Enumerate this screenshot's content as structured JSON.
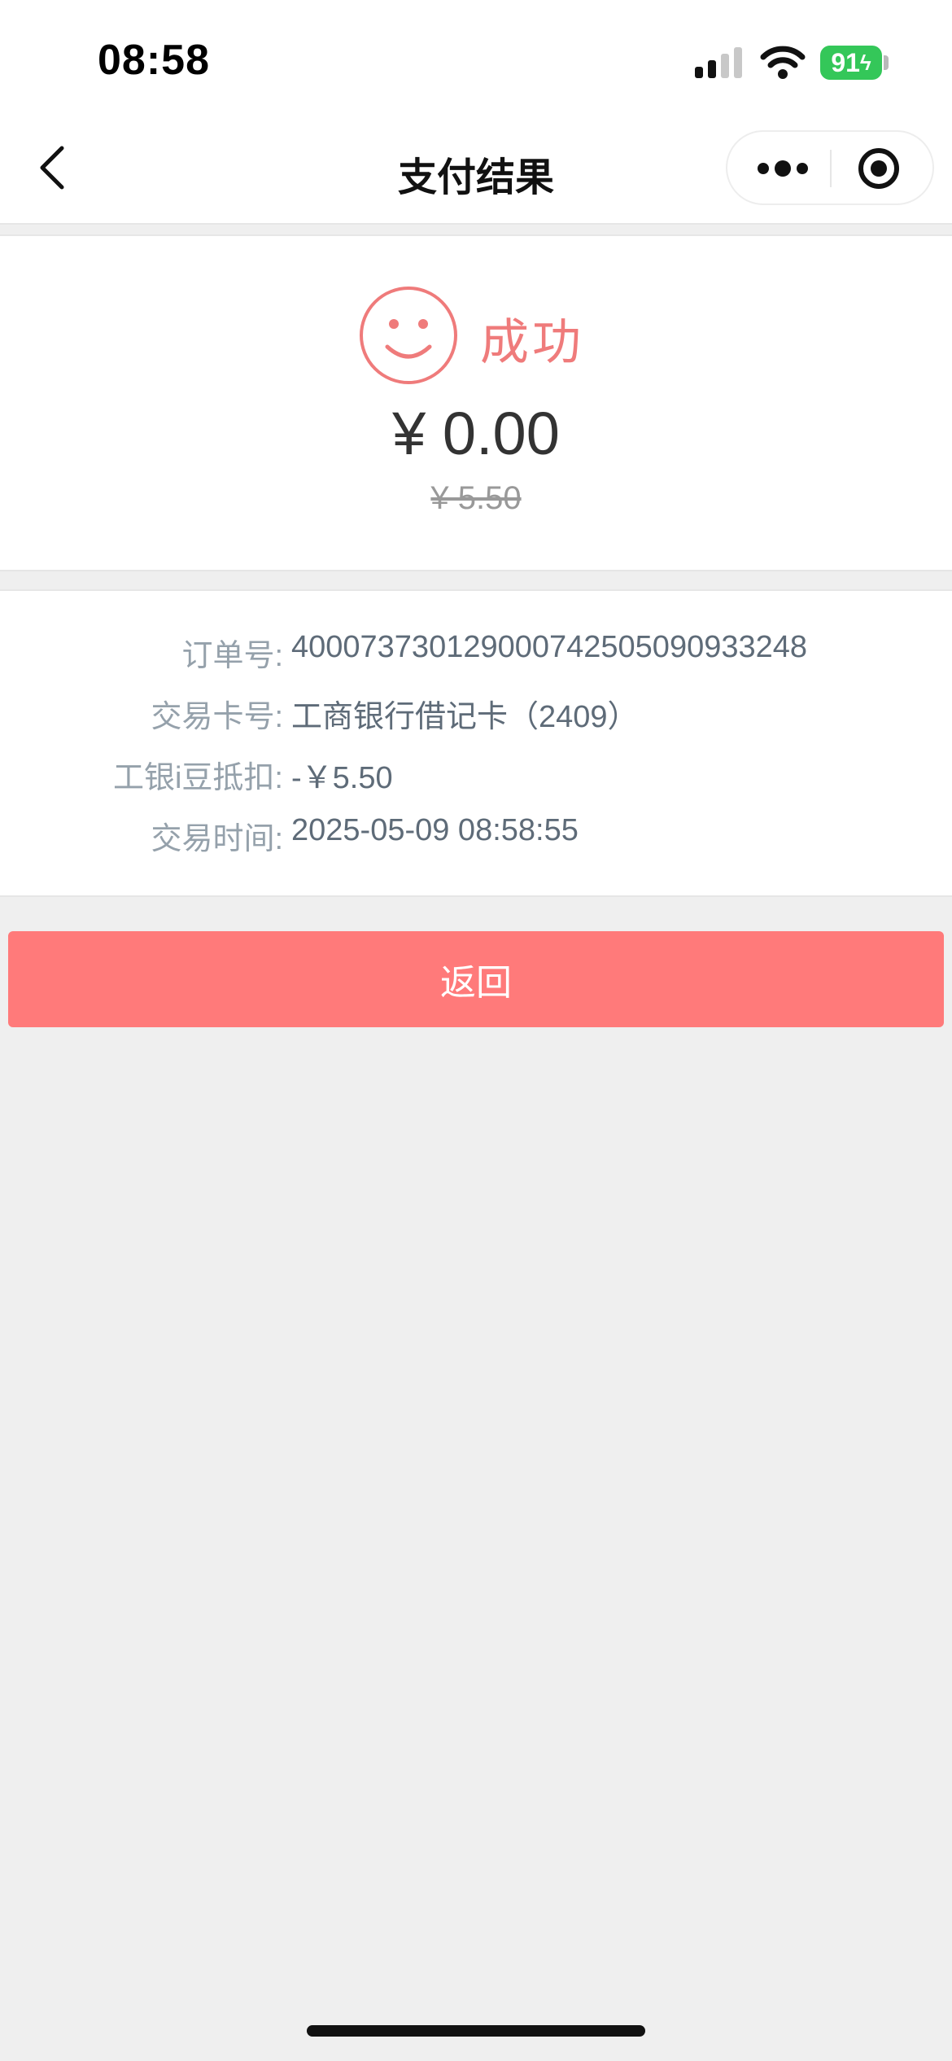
{
  "status_bar": {
    "time": "08:58",
    "battery_level": "91"
  },
  "nav": {
    "title": "支付结果"
  },
  "result": {
    "status_text": "成功",
    "amount": "¥ 0.00",
    "original_amount": "¥ 5.50",
    "accent_color": "#ef7b7b"
  },
  "details": [
    {
      "label": "订单号:",
      "value": "400073730129000742505090933248"
    },
    {
      "label": "交易卡号:",
      "value": "工商银行借记卡（2409）"
    },
    {
      "label": "工银i豆抵扣:",
      "value": "-￥5.50"
    },
    {
      "label": "交易时间:",
      "value": "2025-05-09 08:58:55"
    }
  ],
  "actions": {
    "return_label": "返回",
    "button_color": "#ff7a7a"
  },
  "icons": {
    "back": "chevron-left-icon",
    "more": "more-dots-icon",
    "close": "target-circle-icon",
    "result": "smile-face-icon"
  }
}
